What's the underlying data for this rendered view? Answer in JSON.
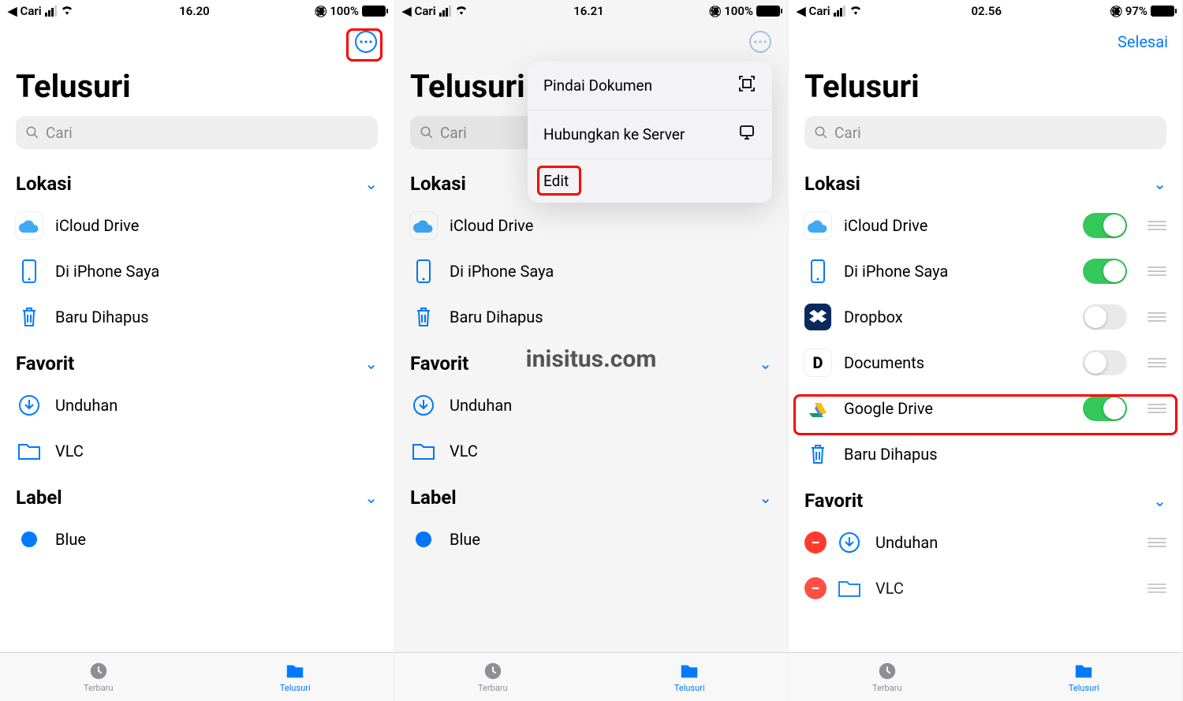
{
  "watermark": "inisitus.com",
  "screens": [
    {
      "statusbar": {
        "back": "Cari",
        "time": "16.20",
        "battery": "100%"
      },
      "nav": {
        "more": true,
        "done": null
      },
      "title": "Telusuri",
      "search_placeholder": "Cari",
      "sections": {
        "lokasi": {
          "title": "Lokasi",
          "items": [
            {
              "icon": "icloud",
              "label": "iCloud Drive"
            },
            {
              "icon": "phone",
              "label": "Di iPhone Saya"
            },
            {
              "icon": "trash",
              "label": "Baru Dihapus"
            }
          ]
        },
        "favorit": {
          "title": "Favorit",
          "items": [
            {
              "icon": "download",
              "label": "Unduhan"
            },
            {
              "icon": "folder",
              "label": "VLC"
            }
          ]
        },
        "label": {
          "title": "Label",
          "items": [
            {
              "icon": "bluedot",
              "label": "Blue"
            }
          ]
        }
      },
      "tabs": {
        "recent": "Terbaru",
        "browse": "Telusuri"
      },
      "highlight_more": true
    },
    {
      "statusbar": {
        "back": "Cari",
        "time": "16.21",
        "battery": "100%"
      },
      "nav": {
        "more": true,
        "done": null
      },
      "title": "Telusuri",
      "search_placeholder": "Cari",
      "popup": {
        "items": [
          {
            "label": "Pindai Dokumen",
            "icon": "scan"
          },
          {
            "label": "Hubungkan ke Server",
            "icon": "server"
          },
          {
            "label": "Edit",
            "icon": null,
            "highlight": true
          }
        ]
      },
      "sections": {
        "lokasi": {
          "title": "Lokasi",
          "items": [
            {
              "icon": "icloud",
              "label": "iCloud Drive"
            },
            {
              "icon": "phone",
              "label": "Di iPhone Saya"
            },
            {
              "icon": "trash",
              "label": "Baru Dihapus"
            }
          ]
        },
        "favorit": {
          "title": "Favorit",
          "items": [
            {
              "icon": "download",
              "label": "Unduhan"
            },
            {
              "icon": "folder",
              "label": "VLC"
            }
          ]
        },
        "label": {
          "title": "Label",
          "items": [
            {
              "icon": "bluedot",
              "label": "Blue"
            }
          ]
        }
      },
      "tabs": {
        "recent": "Terbaru",
        "browse": "Telusuri"
      }
    },
    {
      "statusbar": {
        "back": "Cari",
        "time": "02.56",
        "battery": "97%"
      },
      "nav": {
        "more": false,
        "done": "Selesai"
      },
      "title": "Telusuri",
      "search_placeholder": "Cari",
      "sections": {
        "lokasi": {
          "title": "Lokasi",
          "edit": true,
          "items": [
            {
              "icon": "icloud",
              "label": "iCloud Drive",
              "toggle": true
            },
            {
              "icon": "phone",
              "label": "Di iPhone Saya",
              "toggle": true
            },
            {
              "icon": "dropbox",
              "label": "Dropbox",
              "toggle": false
            },
            {
              "icon": "documents",
              "label": "Documents",
              "toggle": false
            },
            {
              "icon": "gdrive",
              "label": "Google Drive",
              "toggle": true,
              "highlight": true
            },
            {
              "icon": "trash",
              "label": "Baru Dihapus"
            }
          ]
        },
        "favorit": {
          "title": "Favorit",
          "edit": true,
          "items": [
            {
              "icon": "download",
              "label": "Unduhan",
              "removable": true
            },
            {
              "icon": "folder",
              "label": "VLC",
              "removable": true
            }
          ]
        }
      },
      "tabs": {
        "recent": "Terbaru",
        "browse": "Telusuri"
      }
    }
  ]
}
